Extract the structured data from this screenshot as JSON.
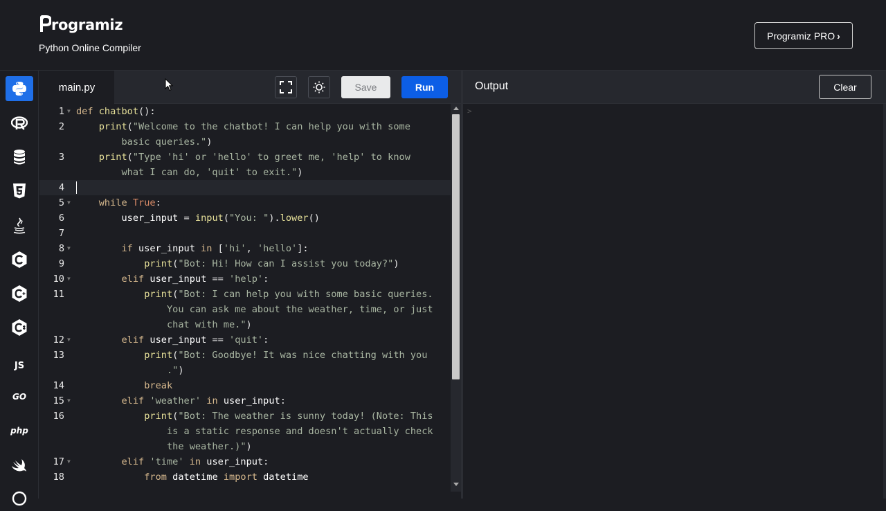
{
  "header": {
    "logo_text": "rogramiz",
    "subtitle": "Python Online Compiler",
    "pro_label": "Programiz PRO"
  },
  "sidebar": {
    "languages": [
      {
        "name": "python",
        "active": true
      },
      {
        "name": "r"
      },
      {
        "name": "sql"
      },
      {
        "name": "html"
      },
      {
        "name": "java"
      },
      {
        "name": "c"
      },
      {
        "name": "cplusplus"
      },
      {
        "name": "csharp"
      },
      {
        "name": "js",
        "label": "JS"
      },
      {
        "name": "go",
        "label": "GO"
      },
      {
        "name": "php",
        "label": "php"
      },
      {
        "name": "swift"
      }
    ]
  },
  "editor": {
    "file_tab": "main.py",
    "save_label": "Save",
    "run_label": "Run"
  },
  "output": {
    "title": "Output",
    "clear_label": "Clear",
    "prompt": ">"
  },
  "code_lines": [
    {
      "n": "1",
      "text": "def chatbot():"
    },
    {
      "n": "2",
      "text": "    print(\"Welcome to the chatbot! I can help you with some"
    },
    {
      "n": "",
      "text": "        basic queries.\")"
    },
    {
      "n": "3",
      "text": "    print(\"Type 'hi' or 'hello' to greet me, 'help' to know"
    },
    {
      "n": "",
      "text": "        what I can do, 'quit' to exit.\")"
    },
    {
      "n": "4",
      "text": ""
    },
    {
      "n": "5",
      "text": "    while True:"
    },
    {
      "n": "6",
      "text": "        user_input = input(\"You: \").lower()"
    },
    {
      "n": "7",
      "text": ""
    },
    {
      "n": "8",
      "text": "        if user_input in ['hi', 'hello']:"
    },
    {
      "n": "9",
      "text": "            print(\"Bot: Hi! How can I assist you today?\")"
    },
    {
      "n": "10",
      "text": "        elif user_input == 'help':"
    },
    {
      "n": "11",
      "text": "            print(\"Bot: I can help you with some basic queries."
    },
    {
      "n": "",
      "text": "                You can ask me about the weather, time, or just"
    },
    {
      "n": "",
      "text": "                chat with me.\")"
    },
    {
      "n": "12",
      "text": "        elif user_input == 'quit':"
    },
    {
      "n": "13",
      "text": "            print(\"Bot: Goodbye! It was nice chatting with you"
    },
    {
      "n": "",
      "text": "                .\")"
    },
    {
      "n": "14",
      "text": "            break"
    },
    {
      "n": "15",
      "text": "        elif 'weather' in user_input:"
    },
    {
      "n": "16",
      "text": "            print(\"Bot: The weather is sunny today! (Note: This"
    },
    {
      "n": "",
      "text": "                is a static response and doesn't actually check"
    },
    {
      "n": "",
      "text": "                the weather.)\")"
    },
    {
      "n": "17",
      "text": "        elif 'time' in user_input:"
    },
    {
      "n": "18",
      "text": "            from datetime import datetime"
    }
  ],
  "colors": {
    "accent": "#0c5ee6",
    "active_language": "#1f6fe8",
    "background": "#1c1d22",
    "panel_bar": "#26282e"
  }
}
